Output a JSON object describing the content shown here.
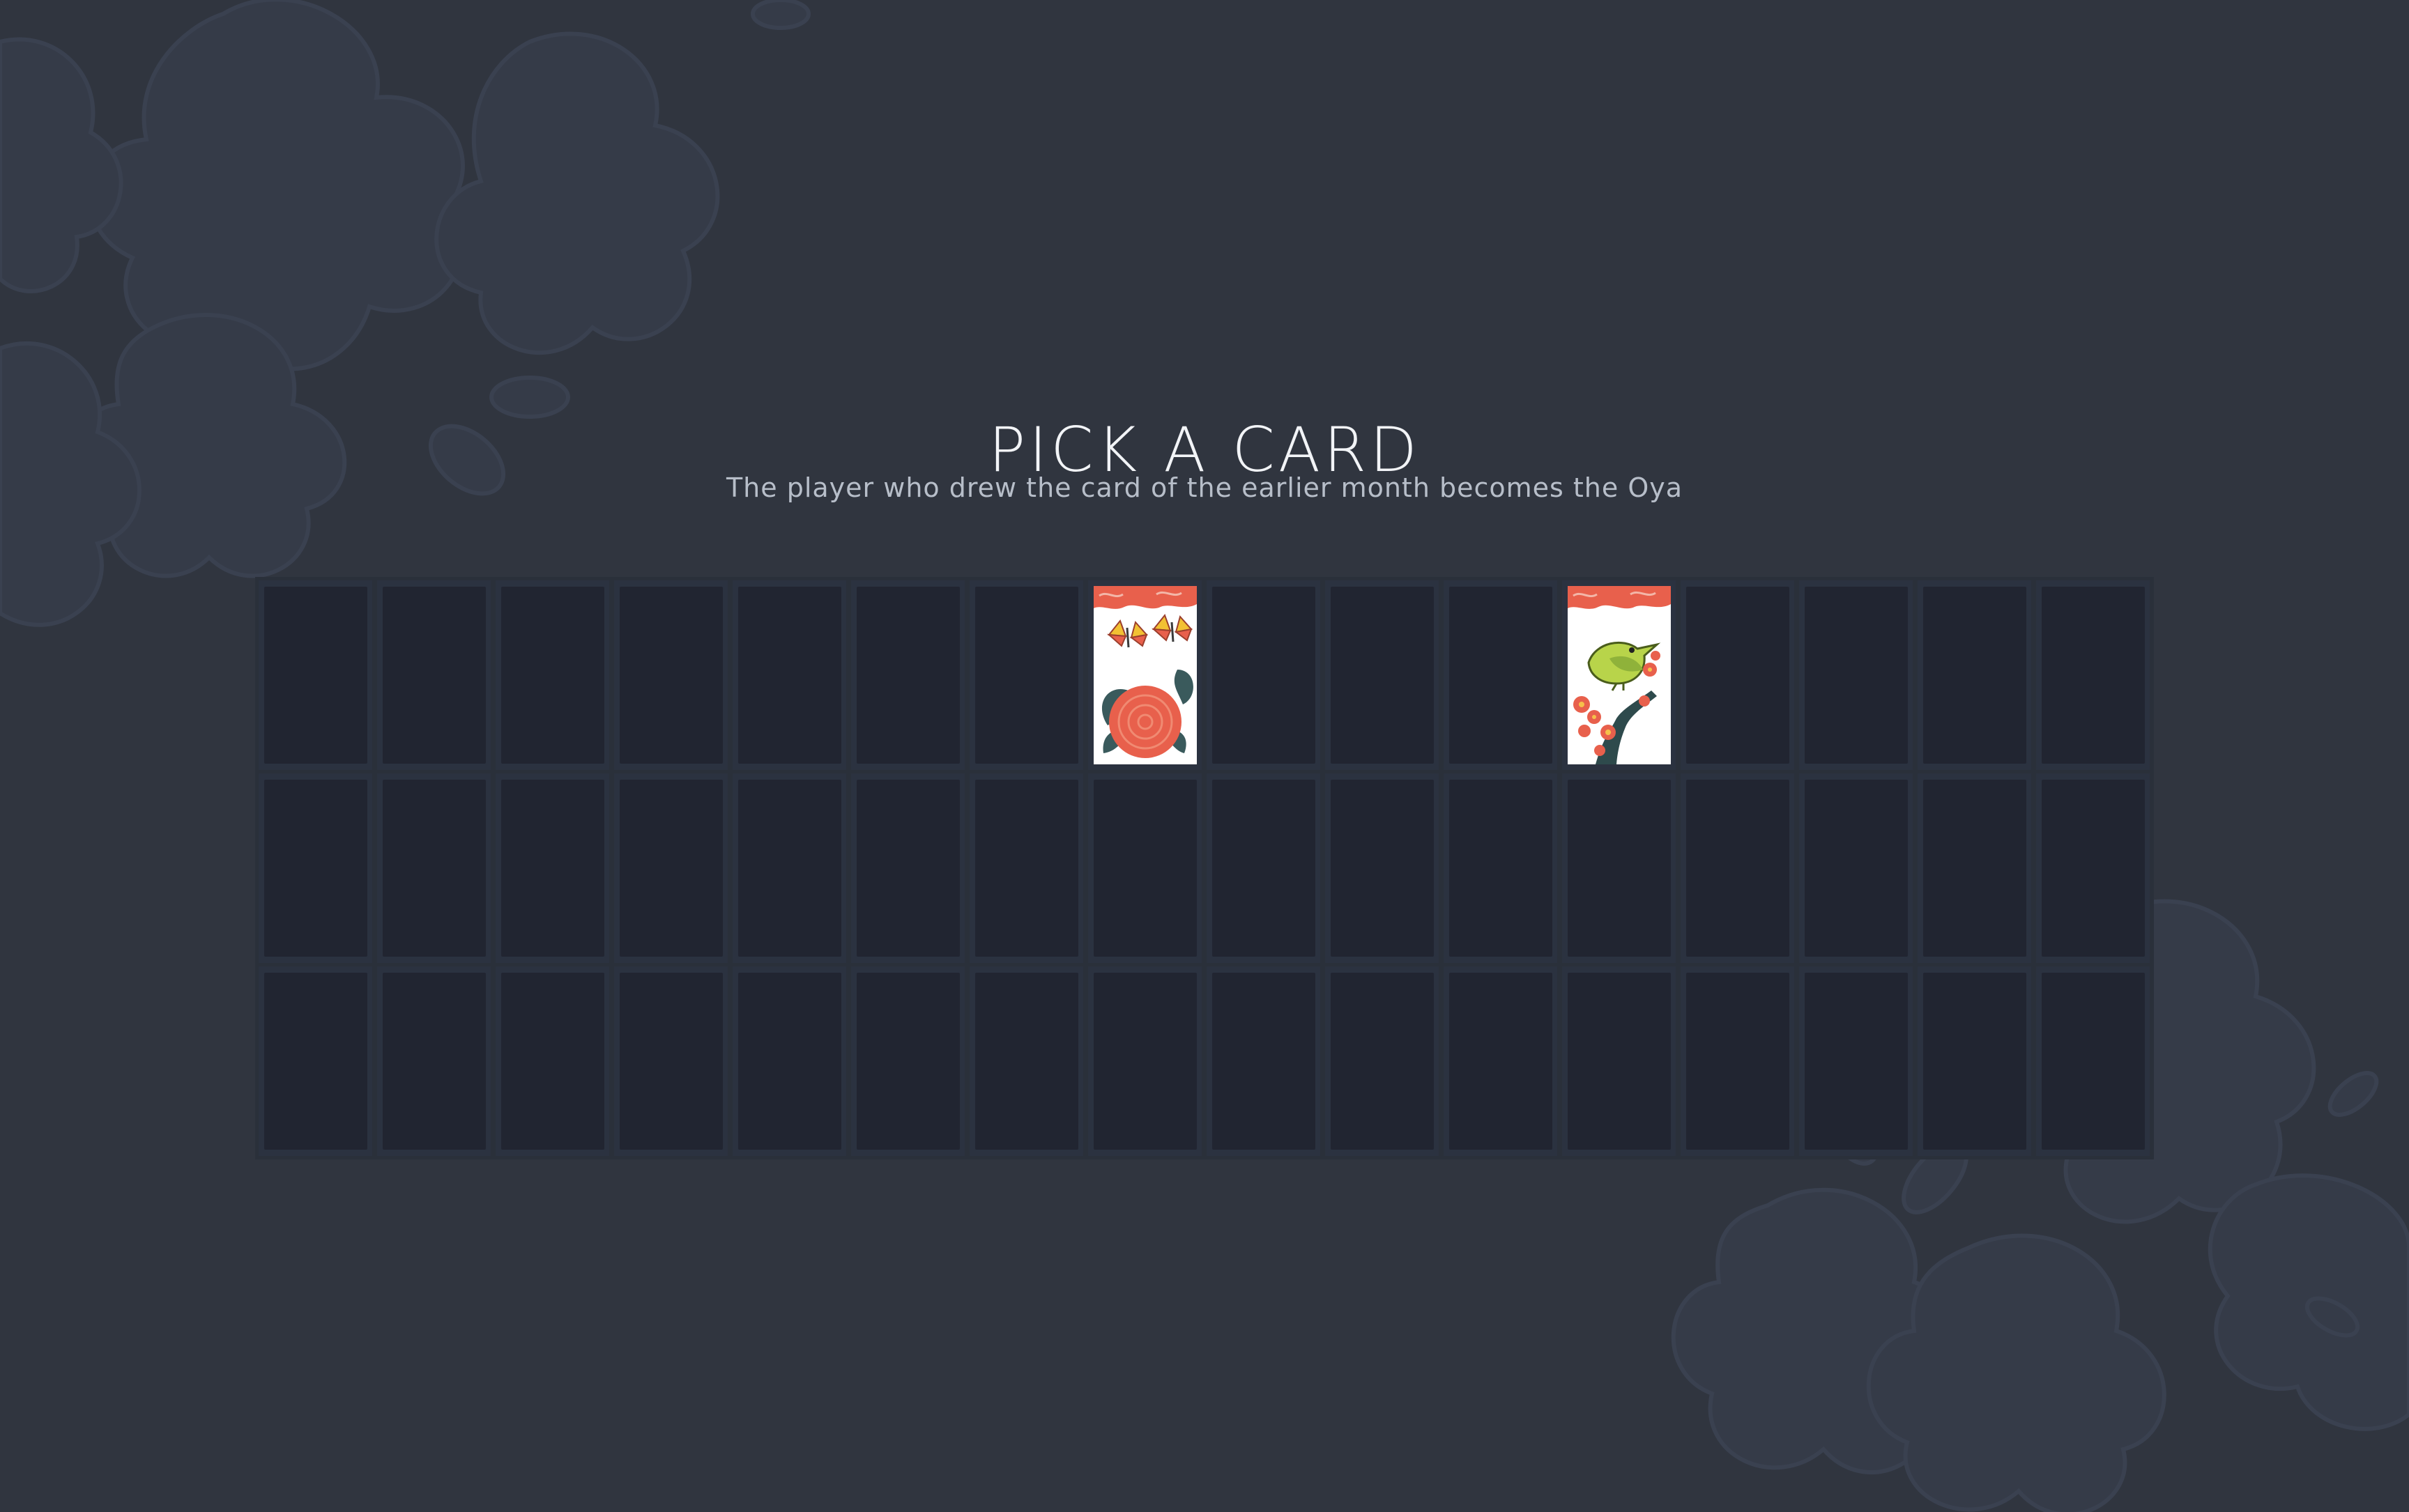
{
  "header": {
    "title": "PICK A CARD",
    "subtitle": "The player who drew the card of the earlier month becomes the Oya"
  },
  "deck": {
    "rows": 3,
    "columns": 16,
    "revealed_cards": [
      {
        "row": 1,
        "column": 8,
        "card": "peony-butterflies-card"
      },
      {
        "row": 1,
        "column": 12,
        "card": "plum-bush-warbler-card"
      }
    ]
  },
  "colors": {
    "background": "#30353f",
    "card_back": "#212531",
    "accent_red": "#e8604c"
  }
}
